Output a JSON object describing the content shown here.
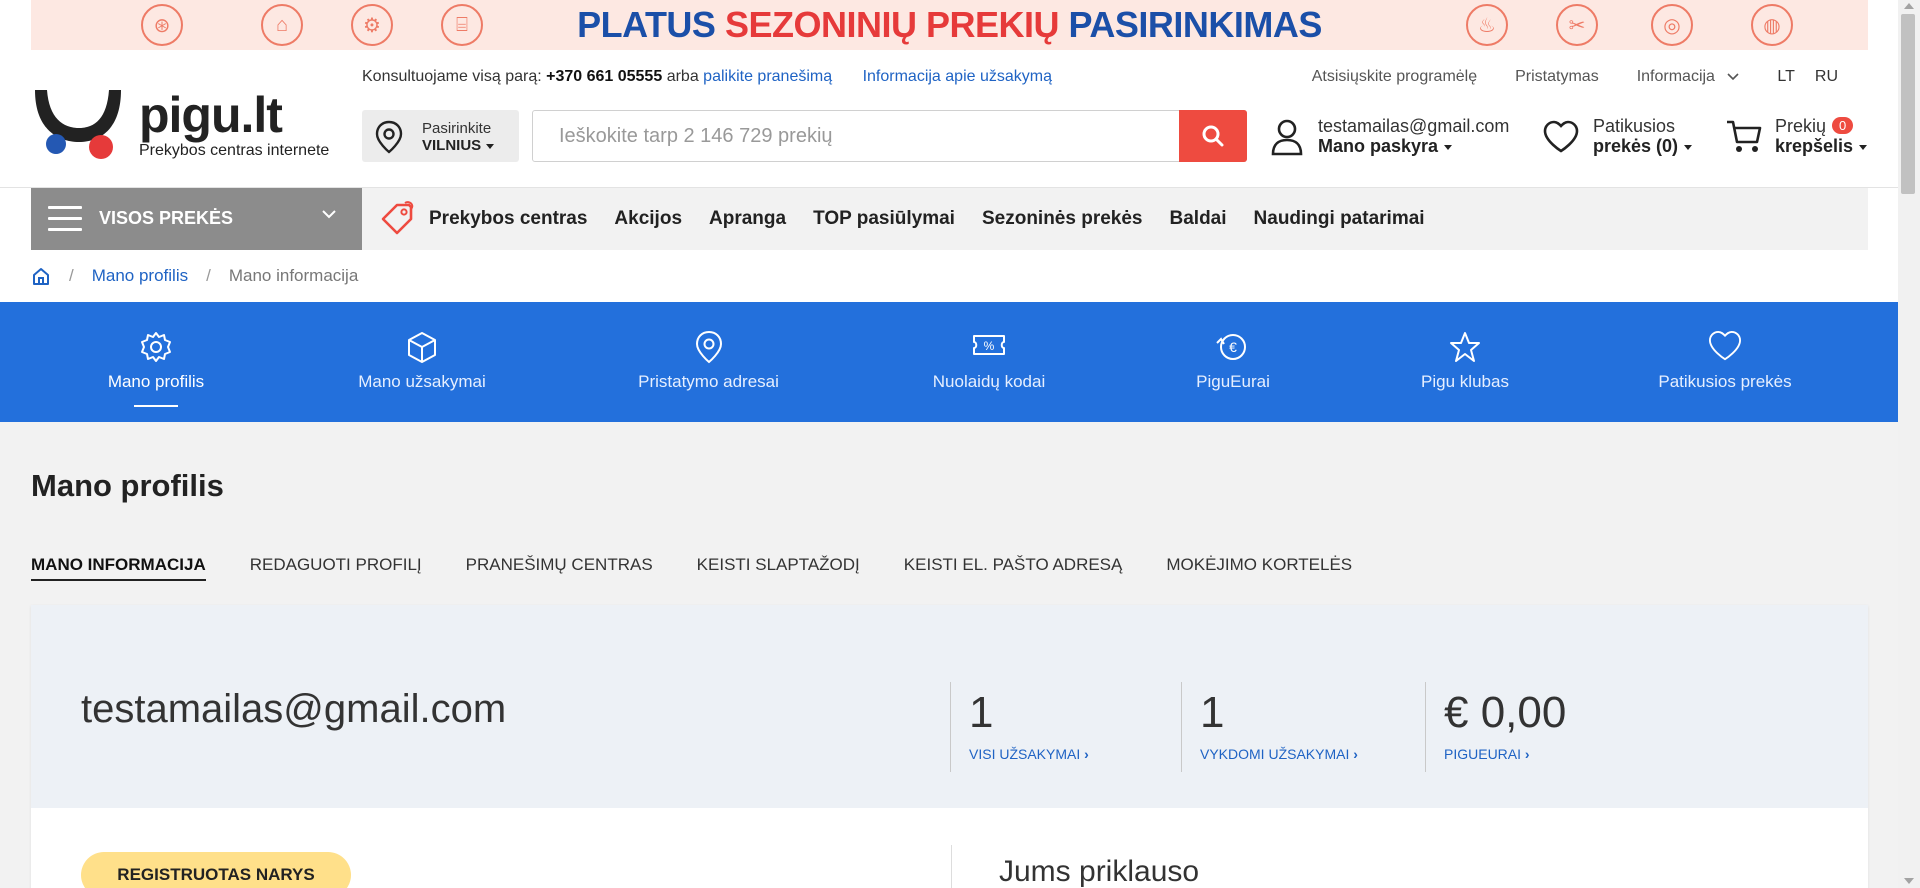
{
  "banner": {
    "text_blue_1": "PLATUS",
    "text_red": "SEZONINIŲ PREKIŲ",
    "text_blue_2": "PASIRINKIMAS"
  },
  "logo": {
    "name": "pigu.lt",
    "tagline": "Prekybos centras internete"
  },
  "topbar": {
    "consult_text": "Konsultuojame visą parą:",
    "phone": "+370 661 05555",
    "or_text": "arba",
    "leave_message": "palikite pranešimą",
    "order_info": "Informacija apie užsakymą",
    "download_app": "Atsisiųskite programėlę",
    "delivery": "Pristatymas",
    "information": "Informacija",
    "lang_lt": "LT",
    "lang_ru": "RU"
  },
  "location": {
    "label": "Pasirinkite",
    "city": "VILNIUS"
  },
  "search": {
    "placeholder": "Ieškokite tarp 2 146 729 prekių"
  },
  "account": {
    "email": "testamailas@gmail.com",
    "label": "Mano paskyra"
  },
  "wishlist": {
    "line1": "Patikusios",
    "line2": "prekės (0)"
  },
  "cart": {
    "line1": "Prekių",
    "count": "0",
    "line2": "krepšelis"
  },
  "nav": {
    "all_products": "VISOS PREKĖS",
    "items": [
      "Prekybos centras",
      "Akcijos",
      "Apranga",
      "TOP pasiūlymai",
      "Sezoninės prekės",
      "Baldai",
      "Naudingi patarimai"
    ]
  },
  "breadcrumb": {
    "profile": "Mano profilis",
    "current": "Mano informacija"
  },
  "profile_tabs": [
    {
      "label": "Mano profilis",
      "icon": "gear-icon"
    },
    {
      "label": "Mano užsakymai",
      "icon": "box-icon"
    },
    {
      "label": "Pristatymo adresai",
      "icon": "map-pin-icon"
    },
    {
      "label": "Nuolaidų kodai",
      "icon": "discount-ticket-icon"
    },
    {
      "label": "PiguEurai",
      "icon": "euro-cycle-icon"
    },
    {
      "label": "Pigu klubas",
      "icon": "star-icon"
    },
    {
      "label": "Patikusios prekės",
      "icon": "heart-icon"
    }
  ],
  "page": {
    "title": "Mano profilis",
    "subtabs": [
      "MANO INFORMACIJA",
      "REDAGUOTI PROFILĮ",
      "PRANEŠIMŲ CENTRAS",
      "KEISTI SLAPTAŽODĮ",
      "KEISTI EL. PAŠTO ADRESĄ",
      "MOKĖJIMO KORTELĖS"
    ]
  },
  "summary": {
    "email": "testamailas@gmail.com",
    "stats": [
      {
        "value": "1",
        "label": "VISI UŽSAKYMAI"
      },
      {
        "value": "1",
        "label": "VYKDOMI UŽSAKYMAI"
      },
      {
        "value": "€ 0,00",
        "label": "PIGUEURAI"
      }
    ],
    "member_badge": "REGISTRUOTAS NARYS",
    "belongs_title": "Jums priklauso"
  },
  "colors": {
    "brand_blue": "#2370dc",
    "accent_red": "#ee4b40",
    "link_blue": "#1f63c4",
    "member_yellow": "#ffe08a"
  }
}
